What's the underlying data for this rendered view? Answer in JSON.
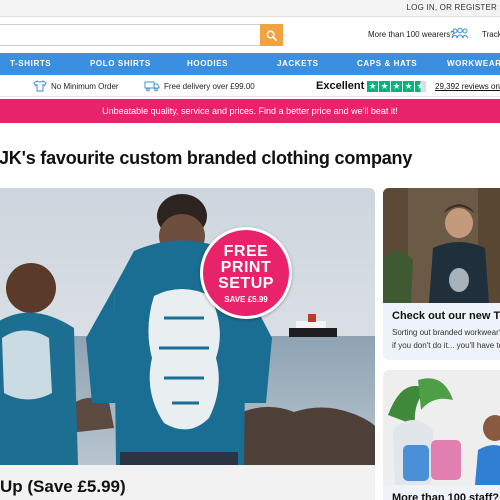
{
  "top_bar": {
    "login_register": "LOG IN, OR REGISTER"
  },
  "header": {
    "search_value": "",
    "wearers_text": "More than 100 wearers?",
    "track_label": "Track"
  },
  "nav": {
    "items": [
      "T-SHIRTS",
      "POLO SHIRTS",
      "HOODIES",
      "JACKETS",
      "CAPS & HATS",
      "WORKWEAR"
    ]
  },
  "usp": {
    "no_minimum": "No Minimum Order",
    "free_delivery": "Free delivery over £99.00",
    "rating_word": "Excellent",
    "rating_stars": 4.5,
    "reviews_text": "29,392 reviews on"
  },
  "promo": {
    "text": "Unbeatable quality, service and prices. Find a better price and we'll beat it!"
  },
  "headline": "JK's favourite custom branded clothing company",
  "hero": {
    "badge_lines": [
      "FREE",
      "PRINT",
      "SETUP"
    ],
    "badge_save": "SAVE £5.99",
    "caption": "Up (Save £5.99)"
  },
  "side_cards": [
    {
      "title": "Check out our new T",
      "text_1": "Sorting out branded workwear?",
      "text_2": "if you don't do it... you'll have to"
    },
    {
      "title": "More than 100 staff?"
    }
  ],
  "colors": {
    "nav_blue": "#3a8fe0",
    "promo_pink": "#e8236c",
    "search_orange": "#f0a342",
    "trustpilot_green": "#00b67a"
  }
}
